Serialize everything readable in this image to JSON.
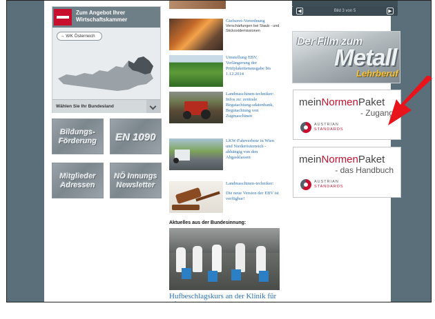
{
  "wk_box": {
    "title_line1": "Zum Angebot Ihrer",
    "title_line2": "Wirtschaftskammer",
    "button": "→ WK Österreich",
    "select_label": "Wählen Sie Ihr Bundesland"
  },
  "tiles": [
    {
      "line1": "Bildungs-",
      "line2": "Förderung"
    },
    {
      "line1": "EN 1090",
      "line2": ""
    },
    {
      "line1": "Mitglieder",
      "line2": "Adressen"
    },
    {
      "line1": "NÖ Innungs",
      "line2": "Newsletter"
    }
  ],
  "news": [
    {
      "title": "Giefserei-Verordnung",
      "sub": "Verschärfungen bei Staub - und Stickoxidemissionen"
    },
    {
      "title": "Umstellung EBV, Verlängerung der Prüfplakettenausgabe bis 1.12.2014",
      "sub": ""
    },
    {
      "title": "Landmaschinen-techniker: Infos zu: zentrale Begutachtung-sdatenbank, Begutachtung von Zugmaschinen",
      "sub": ""
    },
    {
      "title": "LKW-Fahrverbote in Wien und Niederösterreich - abhängig von den Abgasklassen",
      "sub": ""
    },
    {
      "title": "Landmaschinen-techniker:",
      "sub2": "Die neue Version der EBV ist verfügbar!"
    }
  ],
  "section_title": "Aktuelles aus der Bundesinnung:",
  "big_headline": "Hufbeschlagskurs an der Klinik für Pferde der Veterinärmedizinischen Universität Wien",
  "slider": {
    "counter": "Bild 3 von 5",
    "prev": "◀",
    "next": "▶"
  },
  "film_banner": {
    "line1": "Der Film zum",
    "line2": "Metall",
    "line3": "Lehrberuf"
  },
  "norm_boxes": [
    {
      "pre": "mein",
      "accent": "Normen",
      "post": "Paket",
      "sub": "- Zugang",
      "logo1": "AUSTRIAN",
      "logo2": "STANDARDS"
    },
    {
      "pre": "mein",
      "accent": "Normen",
      "post": "Paket",
      "sub": "- das Handbuch",
      "logo1": "AUSTRIAN",
      "logo2": "STANDARDS"
    }
  ],
  "colors": {
    "frame": "#5b6f7b",
    "link": "#2a6fb5",
    "brand_red": "#c8102e",
    "arrow": "#e8141b"
  }
}
